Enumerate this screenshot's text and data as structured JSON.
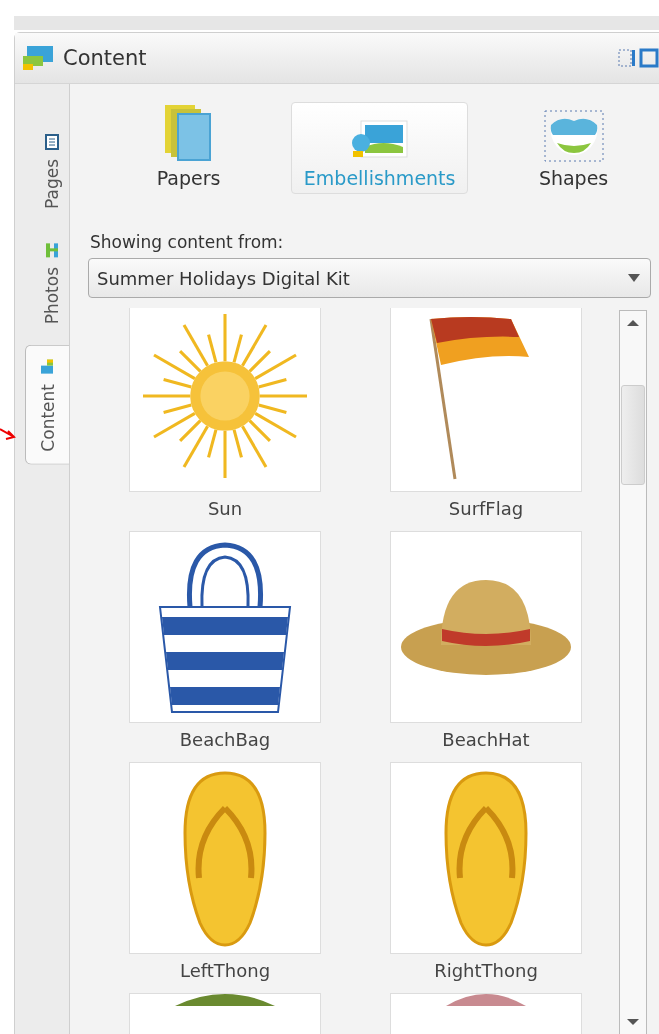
{
  "panel": {
    "title": "Content"
  },
  "side_tabs": [
    {
      "label": "Pages",
      "kind": "pages",
      "selected": false
    },
    {
      "label": "Photos",
      "kind": "photos",
      "selected": false
    },
    {
      "label": "Content",
      "kind": "content",
      "selected": true
    }
  ],
  "categories": [
    {
      "label": "Papers",
      "kind": "papers",
      "selected": false
    },
    {
      "label": "Embellishments",
      "kind": "embellishments",
      "selected": true
    },
    {
      "label": "Shapes",
      "kind": "shapes",
      "selected": false
    }
  ],
  "source": {
    "label": "Showing content from:",
    "value": "Summer Holidays Digital Kit"
  },
  "items": [
    {
      "label": "Sun",
      "kind": "sun"
    },
    {
      "label": "SurfFlag",
      "kind": "flag"
    },
    {
      "label": "BeachBag",
      "kind": "bag"
    },
    {
      "label": "BeachHat",
      "kind": "hat"
    },
    {
      "label": "LeftThong",
      "kind": "thong"
    },
    {
      "label": "RightThong",
      "kind": "thong"
    },
    {
      "kind": "green"
    },
    {
      "kind": "pink"
    }
  ]
}
